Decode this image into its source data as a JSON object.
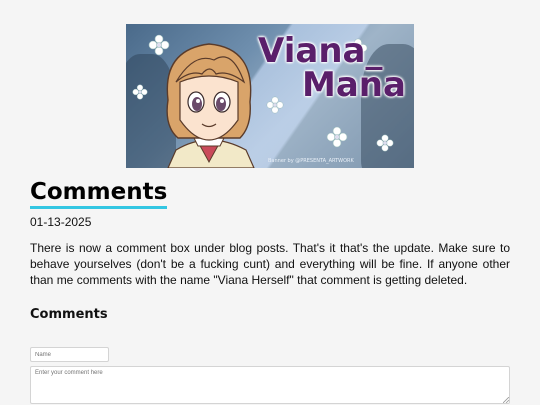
{
  "banner": {
    "title_line1": "Viana_",
    "title_line2": "Mana",
    "credit": "Banner by @PRESENTA_ARTWORK"
  },
  "post": {
    "title": "Comments",
    "date": "01-13-2025",
    "body": "There is now a comment box under blog posts. That's it that's the update. Make sure to behave yourselves (don't be a fucking cunt) and everything will be fine. If anyone other than me comments with the name \"Viana Herself\" that comment is getting deleted."
  },
  "comments": {
    "heading": "Comments",
    "name_placeholder": "Name",
    "comment_placeholder": "Enter your comment here"
  },
  "colors": {
    "title_underline": "#33c6e2",
    "banner_text": "#5a1f6a",
    "background": "#f5f5f5"
  }
}
